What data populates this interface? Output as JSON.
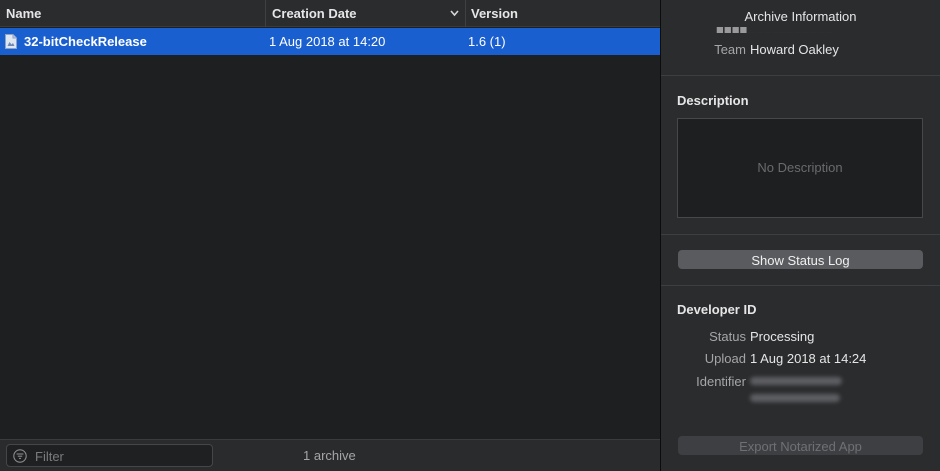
{
  "list": {
    "columns": {
      "name": "Name",
      "creation_date": "Creation Date",
      "version": "Version"
    },
    "rows": [
      {
        "name": "32-bitCheckRelease",
        "creation_date": "1 Aug 2018 at 14:20",
        "version": "1.6 (1)"
      }
    ]
  },
  "footer": {
    "filter_placeholder": "Filter",
    "archive_count": "1 archive"
  },
  "inspector": {
    "title": "Archive Information",
    "team_label": "Team",
    "team_value": "Howard Oakley",
    "description_heading": "Description",
    "description_placeholder": "No Description",
    "show_status_log": "Show Status Log",
    "developer_id_heading": "Developer ID",
    "status_label": "Status",
    "status_value": "Processing",
    "upload_label": "Upload",
    "upload_value": "1 Aug 2018 at 14:24",
    "identifier_label": "Identifier",
    "export_button": "Export Notarized App"
  },
  "icons": {
    "file": "archive-file-icon",
    "sort": "chevron-down-icon",
    "filter": "filter-icon"
  },
  "colors": {
    "selection": "#1a5fd0",
    "background": "#1e1f21",
    "panel": "#2b2c2e"
  }
}
